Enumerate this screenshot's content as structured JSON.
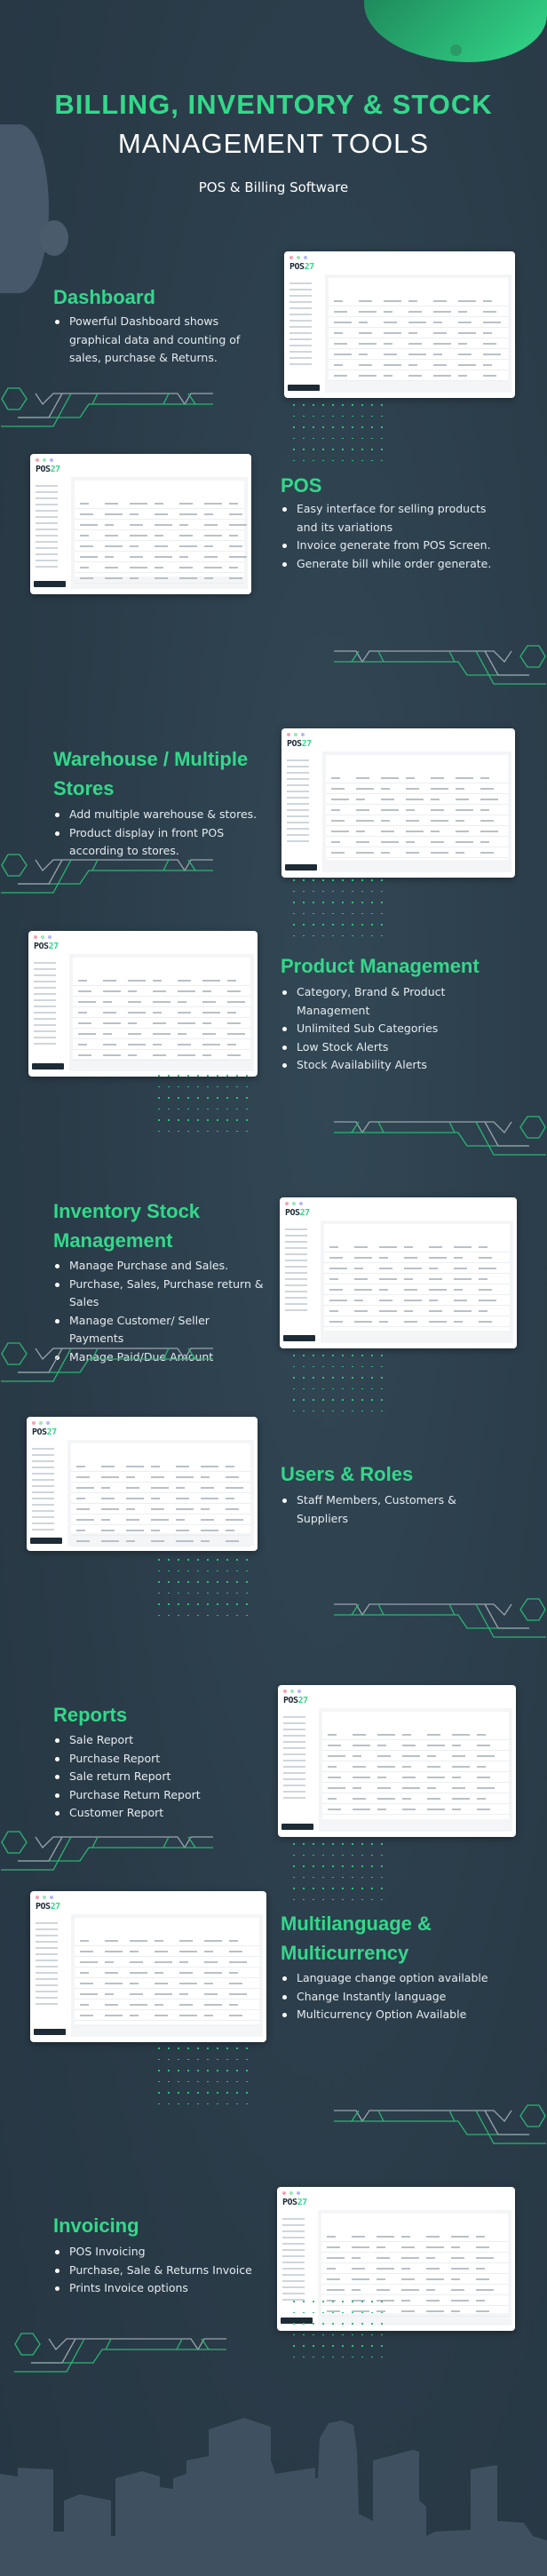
{
  "header": {
    "title_line1": "BILLING, INVENTORY & STOCK",
    "title_line2": "MANAGEMENT TOOLS",
    "subtitle": "POS & Billing Software"
  },
  "brand": {
    "logo_main": "POS",
    "logo_accent": "27",
    "accent": "#34d88b",
    "background": "#2a3b48"
  },
  "sections": [
    {
      "title": "Dashboard",
      "bullets": [
        "Powerful Dashboard shows graphical data and counting of sales, purchase & Returns."
      ]
    },
    {
      "title": "POS",
      "bullets": [
        "Easy interface for selling products and its variations",
        "Invoice generate from POS Screen.",
        "Generate bill while order generate."
      ]
    },
    {
      "title": "Warehouse / Multiple Stores",
      "bullets": [
        "Add multiple warehouse & stores.",
        "Product display in front POS according to stores."
      ]
    },
    {
      "title": "Product Management",
      "bullets": [
        "Category, Brand & Product Management",
        "Unlimited Sub Categories",
        "Low Stock Alerts",
        "Stock Availability Alerts"
      ]
    },
    {
      "title": "Inventory Stock Management",
      "bullets": [
        "Manage Purchase and Sales.",
        "Purchase, Sales, Purchase return & Sales",
        "Manage Customer/ Seller Payments",
        "Manage Paid/Due Amount"
      ]
    },
    {
      "title": "Users & Roles",
      "bullets": [
        "Staff Members, Customers & Suppliers"
      ]
    },
    {
      "title": "Reports",
      "bullets": [
        "Sale Report",
        "Purchase Report",
        "Sale return Report",
        "Purchase Return Report",
        "Customer Report"
      ]
    },
    {
      "title": "Multilanguage & Multicurrency",
      "bullets": [
        "Language change option available",
        "Change Instantly language",
        "Multicurrency Option Available"
      ]
    },
    {
      "title": "Invoicing",
      "bullets": [
        "POS Invoicing",
        "Purchase, Sale & Returns Invoice",
        "Prints Invoice options"
      ]
    }
  ]
}
